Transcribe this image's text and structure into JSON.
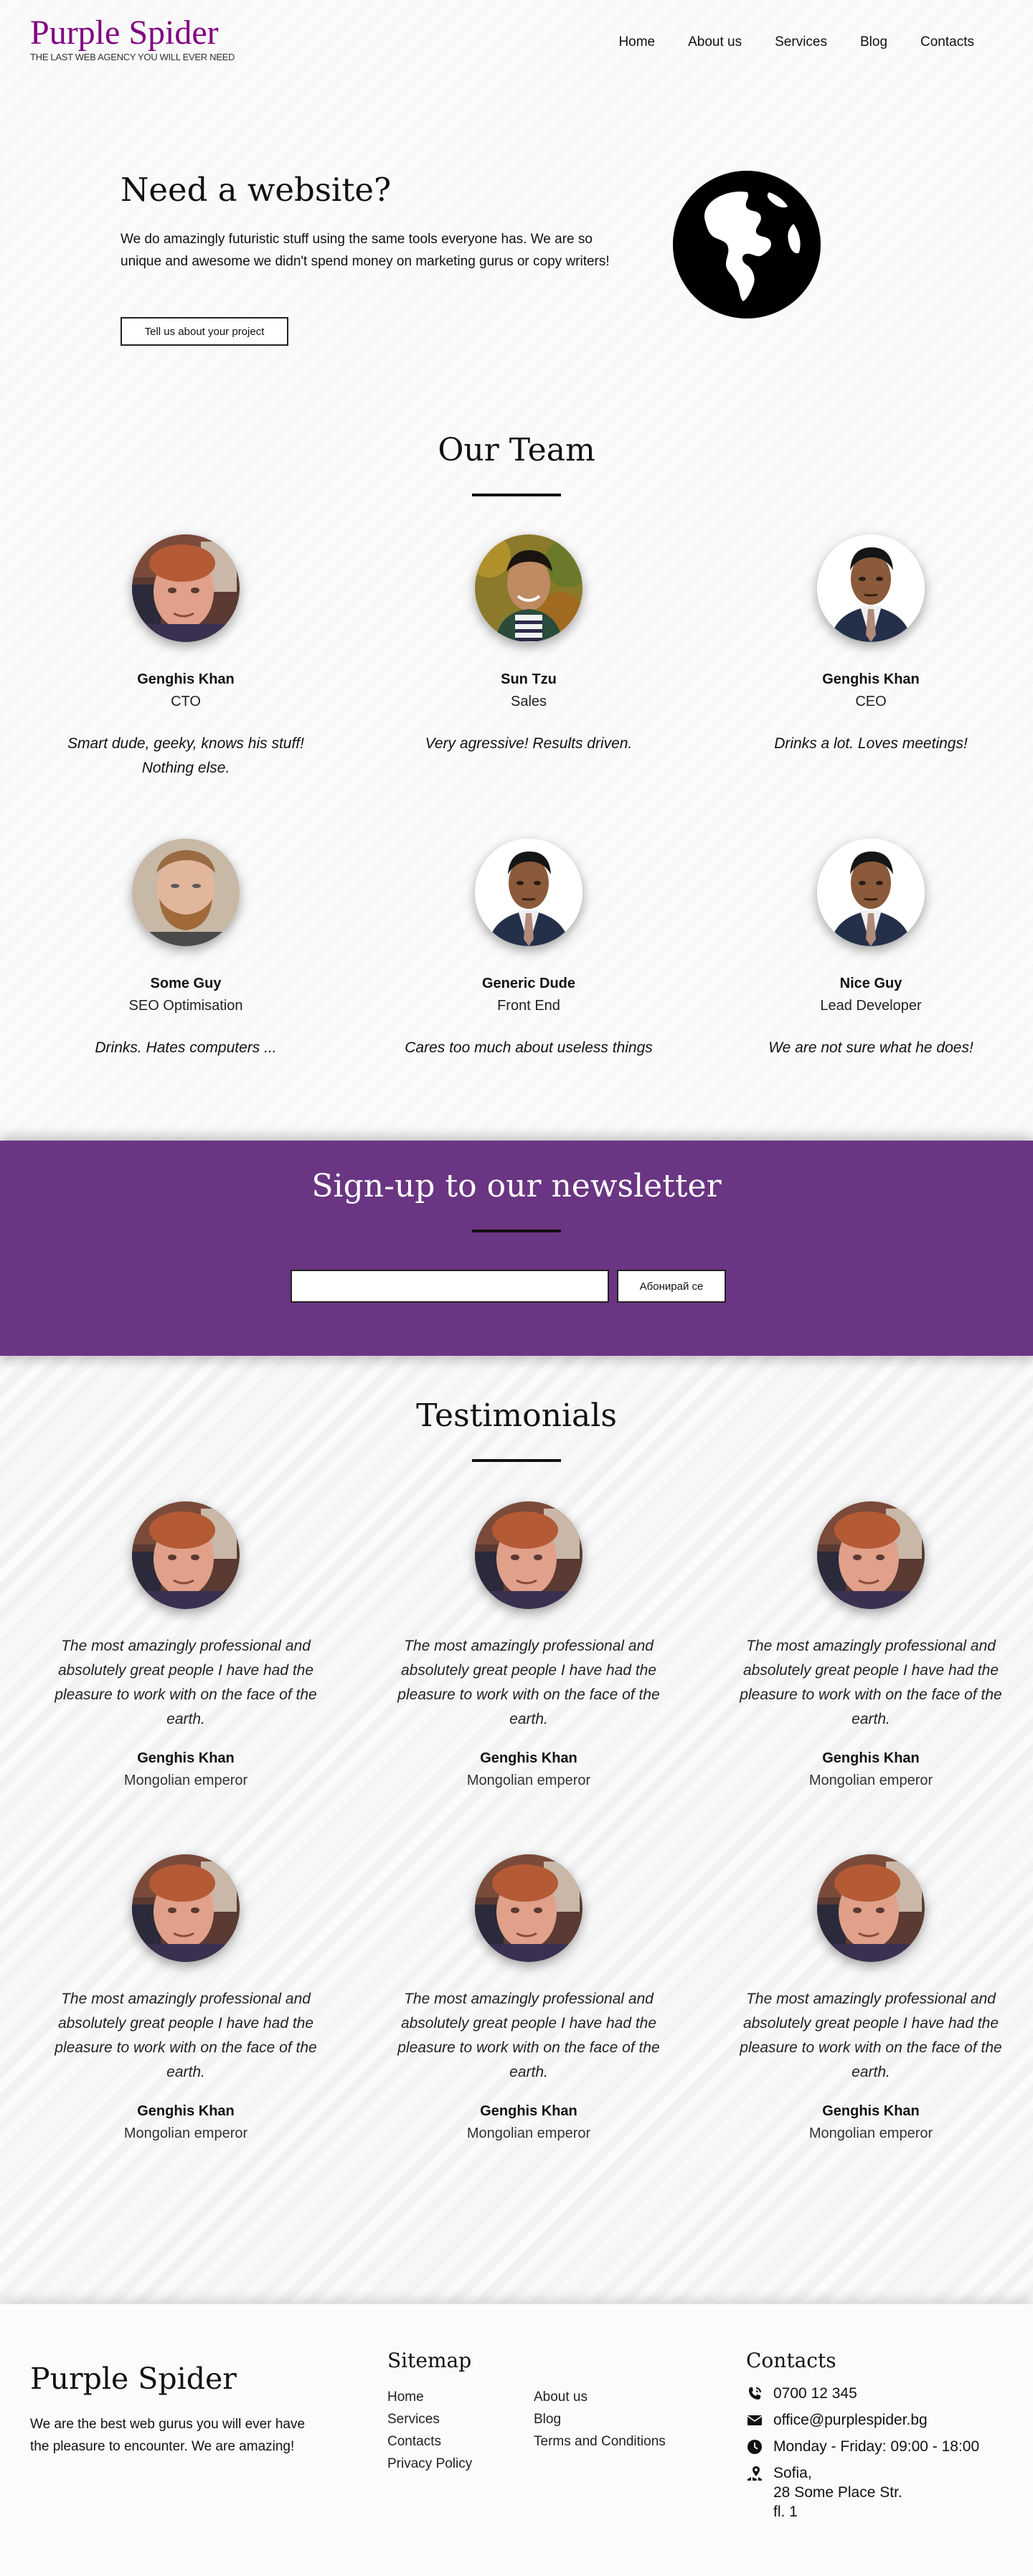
{
  "header": {
    "logo_title": "Purple Spider",
    "logo_tagline": "THE LAST WEB AGENCY YOU WILL EVER NEED",
    "nav": [
      "Home",
      "About us",
      "Services",
      "Blog",
      "Contacts"
    ]
  },
  "hero": {
    "title": "Need a website?",
    "text": "We do amazingly futuristic stuff using the same tools everyone has. We are so unique and awesome we didn't spend money on marketing gurus or copy writers!",
    "button": "Tell us about your project",
    "icon": "globe-icon"
  },
  "team": {
    "title": "Our Team",
    "members": [
      {
        "name": "Genghis Khan",
        "role": "CTO",
        "quote": "Smart dude, geeky, knows his stuff! Nothing else.",
        "avatar": "photo-red-hair"
      },
      {
        "name": "Sun Tzu",
        "role": "Sales",
        "quote": "Very agressive! Results driven.",
        "avatar": "photo-asian-man"
      },
      {
        "name": "Genghis Khan",
        "role": "CEO",
        "quote": "Drinks a lot. Loves meetings!",
        "avatar": "photo-man-suit"
      },
      {
        "name": "Some Guy",
        "role": "SEO Optimisation",
        "quote": "Drinks. Hates computers ...",
        "avatar": "photo-bearded-man"
      },
      {
        "name": "Generic Dude",
        "role": "Front End",
        "quote": "Cares too much about useless things",
        "avatar": "photo-man-suit"
      },
      {
        "name": "Nice Guy",
        "role": "Lead Developer",
        "quote": "We are not sure what he does!",
        "avatar": "photo-man-suit"
      }
    ]
  },
  "newsletter": {
    "title": "Sign-up to our newsletter",
    "input_value": "",
    "button": "Абонирай се",
    "bg_color": "#6a3582"
  },
  "testimonials": {
    "title": "Testimonials",
    "items": [
      {
        "quote": "The most amazingly professional and absolutely great people I have had the pleasure to work with on the face of the earth.",
        "name": "Genghis Khan",
        "title": "Mongolian emperor"
      },
      {
        "quote": "The most amazingly professional and absolutely great people I have had the pleasure to work with on the face of the earth.",
        "name": "Genghis Khan",
        "title": "Mongolian emperor"
      },
      {
        "quote": "The most amazingly professional and absolutely great people I have had the pleasure to work with on the face of the earth.",
        "name": "Genghis Khan",
        "title": "Mongolian emperor"
      },
      {
        "quote": "The most amazingly professional and absolutely great people I have had the pleasure to work with on the face of the earth.",
        "name": "Genghis Khan",
        "title": "Mongolian emperor"
      },
      {
        "quote": "The most amazingly professional and absolutely great people I have had the pleasure to work with on the face of the earth.",
        "name": "Genghis Khan",
        "title": "Mongolian emperor"
      },
      {
        "quote": "The most amazingly professional and absolutely great people I have had the pleasure to work with on the face of the earth.",
        "name": "Genghis Khan",
        "title": "Mongolian emperor"
      }
    ]
  },
  "footer": {
    "brand": "Purple Spider",
    "about": "We are the best web gurus you will ever have the pleasure to encounter. We are amazing!",
    "sitemap_title": "Sitemap",
    "sitemap_col1": [
      "Home",
      "Services",
      "Contacts",
      "Privacy Policy"
    ],
    "sitemap_col2": [
      "About us",
      "Blog",
      "Terms and Conditions"
    ],
    "contacts_title": "Contacts",
    "phone": "0700 12 345",
    "email": "office@purplespider.bg",
    "hours": "Monday - Friday: 09:00 - 18:00",
    "address": [
      "Sofia,",
      "28 Some Place Str.",
      "fl. 1"
    ]
  },
  "colors": {
    "brand": "#800080",
    "newsletter": "#6a3582"
  }
}
